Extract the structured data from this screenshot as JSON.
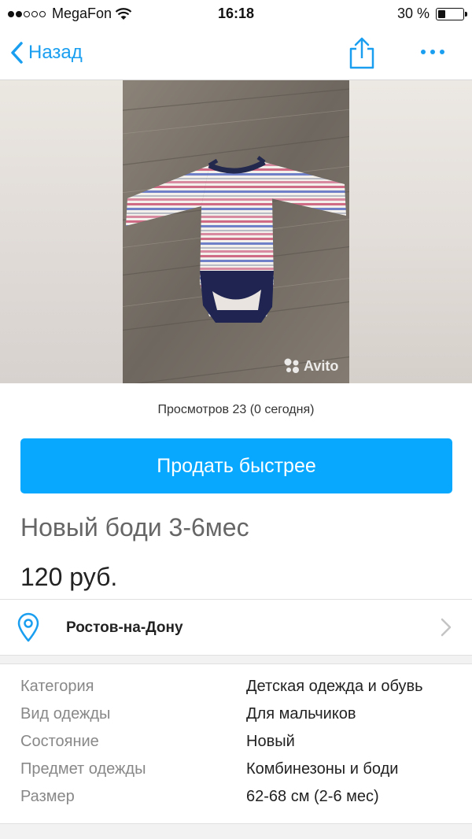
{
  "status_bar": {
    "carrier": "MegaFon",
    "time": "16:18",
    "battery_percent": "30 %",
    "battery_level": 0.3,
    "signal_bars_filled": 2,
    "signal_bars_total": 5
  },
  "nav": {
    "back_label": "Назад",
    "share_icon": "share-icon",
    "more_icon": "more-icon"
  },
  "photo": {
    "watermark": "Avito"
  },
  "views_text": "Просмотров 23 (0 сегодня)",
  "sell_button": "Продать быстрее",
  "title": "Новый боди 3-6мес",
  "price": "120 руб.",
  "location": {
    "name": "Ростов-на-Дону",
    "icon": "location-pin-icon"
  },
  "params": [
    {
      "label": "Категория",
      "value": "Детская одежда и обувь"
    },
    {
      "label": "Вид одежды",
      "value": "Для мальчиков"
    },
    {
      "label": "Состояние",
      "value": "Новый"
    },
    {
      "label": "Предмет одежды",
      "value": "Комбинезоны и боди"
    },
    {
      "label": "Размер",
      "value": "62-68 см (2-6 мес)"
    }
  ],
  "colors": {
    "accent": "#08a8ff",
    "link": "#1a9ff0"
  }
}
